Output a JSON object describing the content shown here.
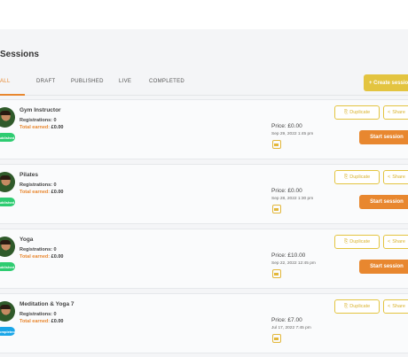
{
  "page": {
    "title": "Sessions"
  },
  "tabs": [
    {
      "label": "ALL",
      "active": true
    },
    {
      "label": "DRAFT"
    },
    {
      "label": "PUBLISHED"
    },
    {
      "label": "LIVE"
    },
    {
      "label": "COMPLETED"
    }
  ],
  "create_button": {
    "label": "+ Create session"
  },
  "labels": {
    "registrations": "Registrations:",
    "total_earned": "Total earned:",
    "duplicate": "Duplicate",
    "share": "Share",
    "start": "Start session"
  },
  "colors": {
    "accent": "#e8872f",
    "gold": "#e3c440",
    "published": "#2ecc71",
    "completed": "#1aa6e8"
  },
  "sessions": [
    {
      "name": "Gym Instructor",
      "registrations": "0",
      "earned": "£0.00",
      "status": "Published",
      "price": "Price: £0.00",
      "date": "Sep 29, 2022 1:45 pm",
      "can_start": true
    },
    {
      "name": "Pilates",
      "registrations": "0",
      "earned": "£0.00",
      "status": "Published",
      "price": "Price: £0.00",
      "date": "Sep 28, 2022 1:30 pm",
      "can_start": true
    },
    {
      "name": "Yoga",
      "registrations": "0",
      "earned": "£0.00",
      "status": "Published",
      "price": "Price: £10.00",
      "date": "Sep 22, 2022 12:45 pm",
      "can_start": true
    },
    {
      "name": "Meditation & Yoga 7",
      "registrations": "0",
      "earned": "£0.00",
      "status": "Completed",
      "price": "Price: £7.00",
      "date": "Jul 17, 2022 7:45 pm",
      "can_start": false
    }
  ]
}
